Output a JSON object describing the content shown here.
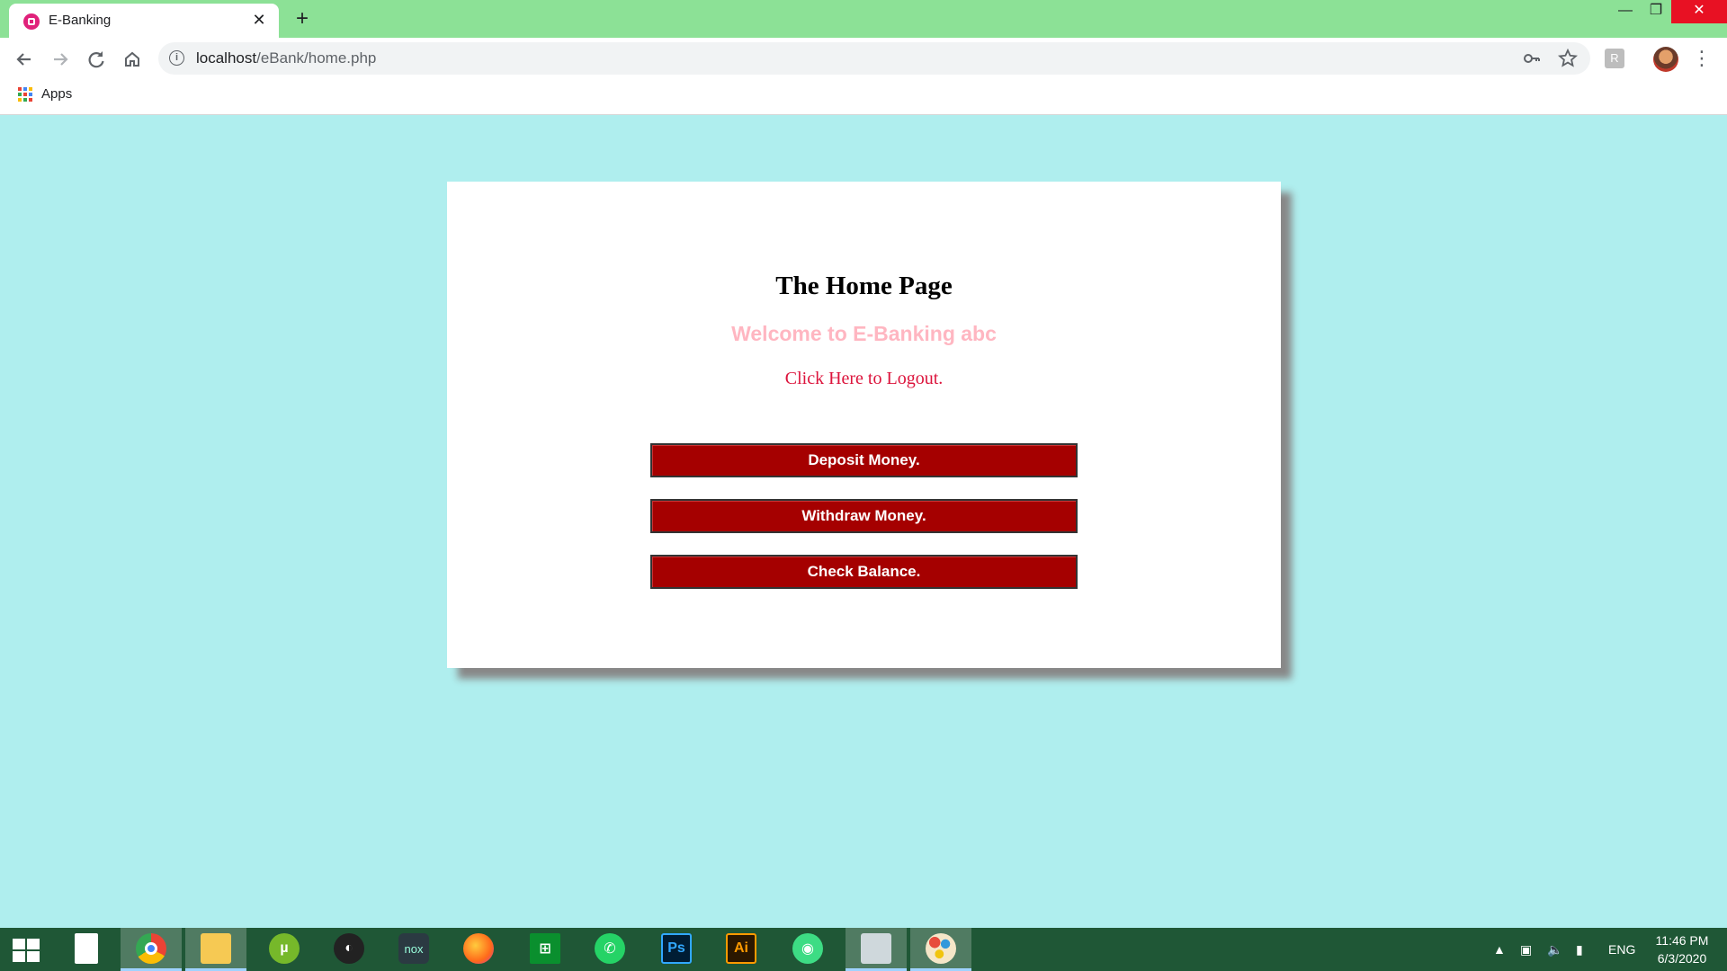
{
  "browser": {
    "tab_title": "E-Banking",
    "tab_close": "✕",
    "new_tab": "+",
    "window_minimize": "—",
    "window_maximize": "❐",
    "window_close": "✕",
    "url_host": "localhost",
    "url_path": "/eBank/home.php",
    "bookmarks_apps": "Apps"
  },
  "page": {
    "title": "The Home Page",
    "welcome": "Welcome to E-Banking abc",
    "logout": "Click Here to Logout.",
    "buttons": {
      "deposit": "Deposit Money.",
      "withdraw": "Withdraw Money.",
      "balance": "Check Balance."
    }
  },
  "taskbar": {
    "apps": [
      "windows-start",
      "file",
      "chrome",
      "file-explorer",
      "utorrent",
      "audio-app",
      "nox-player",
      "firefox",
      "microsoft-store",
      "whatsapp",
      "photoshop",
      "illustrator",
      "android-studio",
      "print-app",
      "paint"
    ],
    "photoshop_label": "Ps",
    "illustrator_label": "Ai",
    "nox_label": "nox",
    "language": "ENG",
    "time": "11:46 PM",
    "date": "6/3/2020"
  },
  "colors": {
    "page_background": "#afeeee",
    "title_bar": "#8ce196",
    "button_background": "#a50000",
    "welcome_text": "#ffb6c1",
    "logout_link": "#dc143c",
    "taskbar": "#1f5736"
  }
}
